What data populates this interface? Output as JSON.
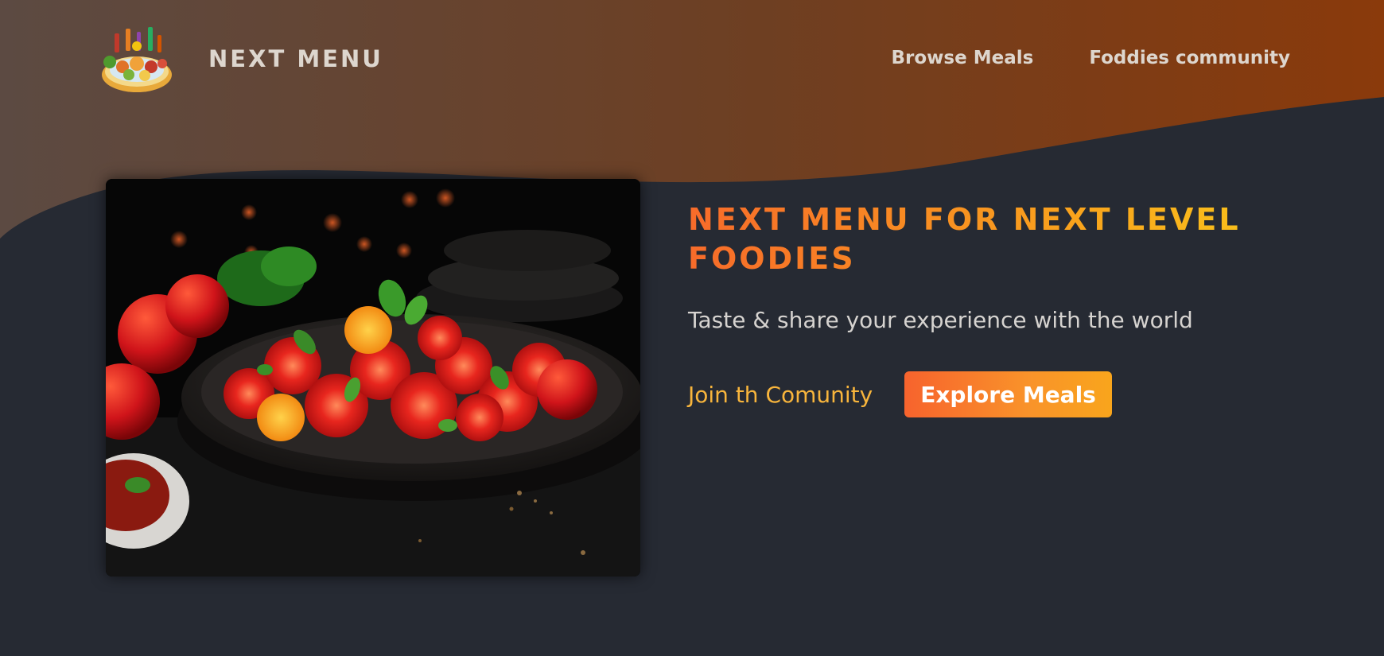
{
  "header": {
    "logo_text": "NEXT MENU",
    "logo_icon": "food-platter-icon",
    "nav": [
      {
        "label": "Browse Meals"
      },
      {
        "label": "Foddies community"
      }
    ]
  },
  "hero": {
    "image_icon": "tomato-salad-photo",
    "title": "NEXT MENU FOR NEXT LEVEL FOODIES",
    "subtitle": "Taste & share your experience with the world",
    "join_link": "Join th Comunity",
    "explore_button": "Explore Meals"
  },
  "colors": {
    "background": "#262a33",
    "header_gradient_start": "#5c4a42",
    "header_gradient_end": "#8a3a0b",
    "accent_orange": "#f7632d",
    "accent_yellow": "#f9c21b",
    "nav_text": "#ddd6ce"
  }
}
